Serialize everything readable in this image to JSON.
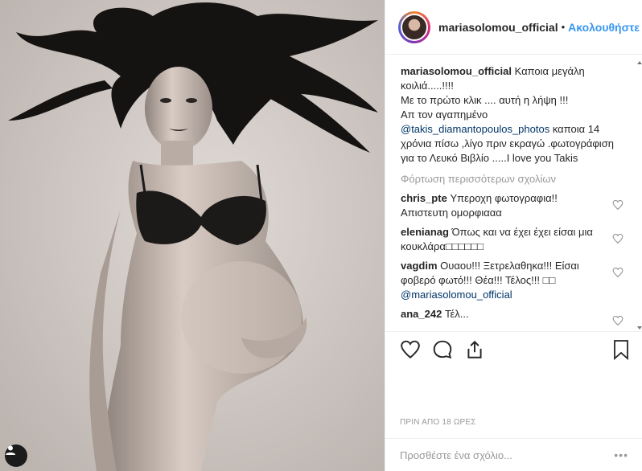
{
  "post": {
    "username": "mariasolomou_official",
    "separator": "•",
    "follow_label": "Ακολουθήστε",
    "caption": {
      "username": "mariasolomou_official",
      "line1": "Καποια μεγάλη κοιλιά.....!!!!",
      "line2": "Με το πρώτο κλικ .... αυτή η λήψη !!!",
      "line3": "Απ τον αγαπημένο",
      "mention": "@takis_diamantopoulos_photos",
      "line4": " καποια 14 χρόνια πίσω ,λίγο πριν εκραγώ .φωτογράφιση για το Λευκό Βιβλίο .....I love you Takis"
    },
    "load_more_label": "Φόρτωση περισσότερων σχολίων",
    "comments": [
      {
        "username": "chris_pte",
        "text": "Υπεροχη φωτογραφια!! Απιστευτη ομορφιααα"
      },
      {
        "username": "elenianag",
        "text": "Όπως και να έχει έχει είσαι μια κουκλάρα□□□□□□"
      },
      {
        "username": "vagdim",
        "text": "Ουαου!!! Ξετρελαθηκα!!! Είσαι φοβερό φωτό!!! Θέα!!! Τέλος!!! □□",
        "mention": "@mariasolomou_official"
      },
      {
        "username": "ana_242",
        "text": "Τέλ..."
      }
    ],
    "timestamp": "ΠΡΙΝ ΑΠΟ 18 ΩΡΕΣ",
    "add_comment_placeholder": "Προσθέστε ένα σχόλιο...",
    "more_label": "•••"
  },
  "icons": {
    "heart": "heart-icon",
    "comment": "comment-icon",
    "share": "share-icon",
    "bookmark": "bookmark-icon"
  },
  "colors": {
    "link_blue": "#3897f0",
    "mention": "#003569",
    "muted": "#999999",
    "text": "#262626"
  }
}
